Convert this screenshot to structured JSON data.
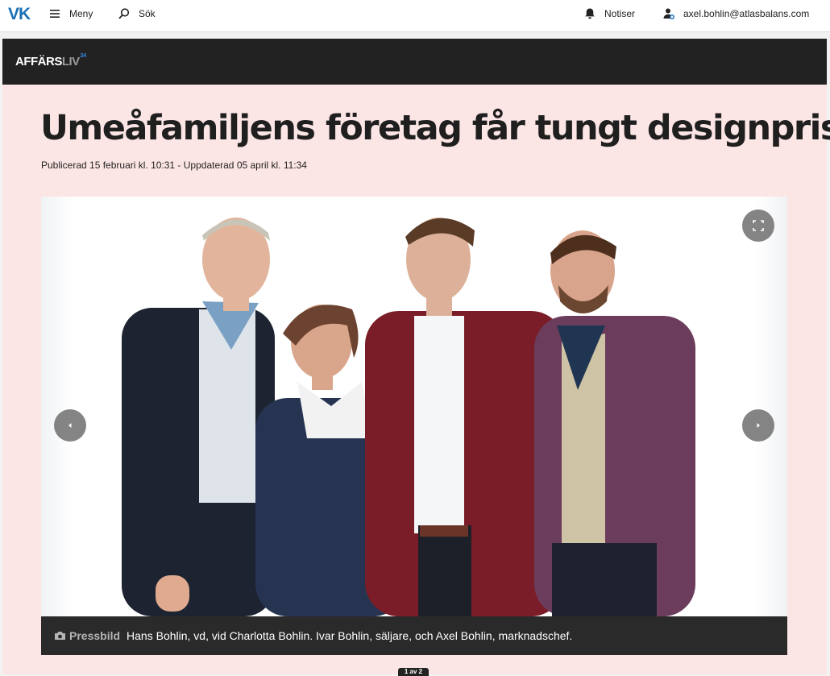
{
  "nav": {
    "logo": "VK",
    "menu_label": "Meny",
    "search_label": "Sök",
    "notifications_label": "Notiser",
    "account_email": "axel.bohlin@atlasbalans.com"
  },
  "brand": {
    "name_main": "AFFÄRS",
    "name_accent": "LIV",
    "name_super": "24"
  },
  "article": {
    "title": "Umeåfamiljens företag får tungt designpris",
    "meta": "Publicerad 15 februari kl. 10:31 - Uppdaterad 05 april kl. 11:34"
  },
  "gallery": {
    "credit": "Pressbild",
    "caption": "Hans Bohlin, vd, vid Charlotta Bohlin. Ivar Bohlin, säljare, och Axel Bohlin, marknadschef.",
    "pager": "1 av 2"
  },
  "colors": {
    "page_bg": "#fce6e5",
    "brandbar": "#222222",
    "logo_blue": "#1b6fb5"
  },
  "icons": {
    "menu": "hamburger-icon",
    "search": "search-icon",
    "notifications": "bell-icon",
    "account": "user-icon",
    "prev": "chevron-left-icon",
    "next": "chevron-right-icon",
    "fullscreen": "fullscreen-icon",
    "camera": "camera-icon"
  }
}
